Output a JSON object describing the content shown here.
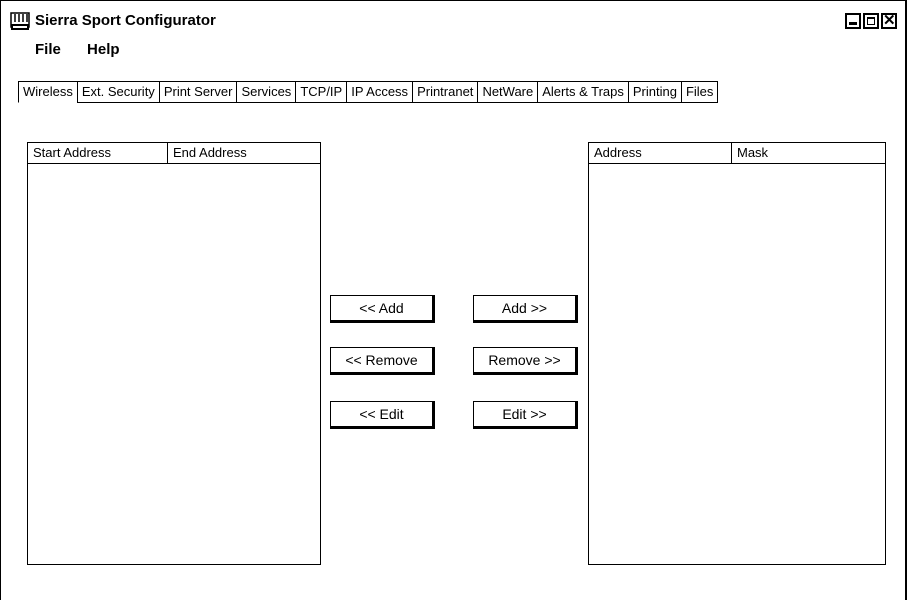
{
  "window": {
    "title": "Sierra Sport Configurator"
  },
  "menu": {
    "file": "File",
    "help": "Help"
  },
  "tabs": [
    "Wireless",
    "Ext. Security",
    "Print Server",
    "Services",
    "TCP/IP",
    "IP Access",
    "Printranet",
    "NetWare",
    "Alerts & Traps",
    "Printing",
    "Files"
  ],
  "active_tab": "Wireless",
  "left_list": {
    "col1": "Start Address",
    "col2": "End Address",
    "rows": []
  },
  "right_list": {
    "col1": "Address",
    "col2": "Mask",
    "rows": []
  },
  "buttons": {
    "add_left": "<< Add",
    "remove_left": "<< Remove",
    "edit_left": "<< Edit",
    "add_right": "Add >>",
    "remove_right": "Remove >>",
    "edit_right": "Edit >>"
  },
  "icons": {
    "app": "printer-server-icon",
    "minimize": "minimize-icon",
    "maximize": "maximize-icon",
    "close": "close-icon"
  }
}
